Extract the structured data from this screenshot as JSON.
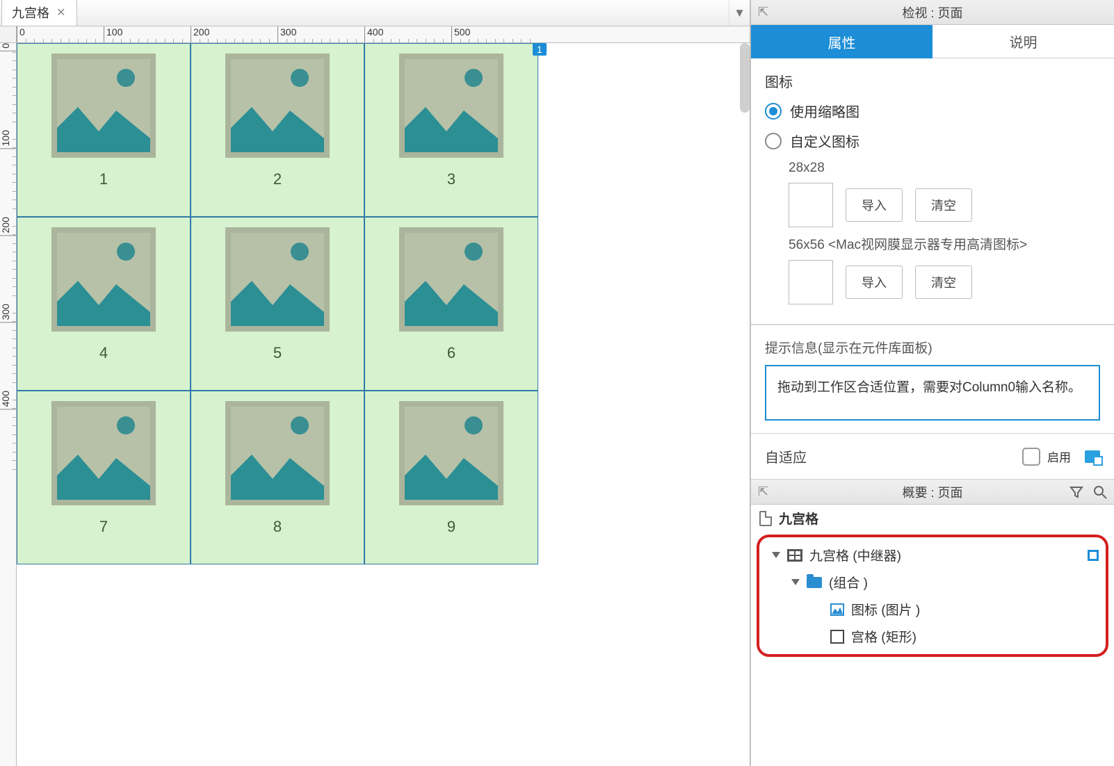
{
  "tab": {
    "title": "九宫格"
  },
  "ruler": {
    "h": [
      "0",
      "100",
      "200",
      "300",
      "400",
      "500"
    ],
    "v": [
      "0",
      "100",
      "200",
      "300",
      "400"
    ]
  },
  "badge": "1",
  "grid_labels": [
    "1",
    "2",
    "3",
    "4",
    "5",
    "6",
    "7",
    "8",
    "9"
  ],
  "inspector": {
    "panel_title": "检视 : 页面",
    "tabs": {
      "props": "属性",
      "notes": "说明"
    },
    "icon_section": "图标",
    "radio_thumb": "使用缩略图",
    "radio_custom": "自定义图标",
    "spec_small": "28x28",
    "spec_large": "56x56 <Mac视网膜显示器专用高清图标>",
    "btn_import": "导入",
    "btn_clear": "清空",
    "hint_label": "提示信息(显示在元件库面板)",
    "hint_text": "拖动到工作区合适位置，需要对Column0输入名称。",
    "adaptive_label": "自适应",
    "enable_label": "启用"
  },
  "outline": {
    "panel_title": "概要 : 页面",
    "page_name": "九宫格",
    "repeater": "九宫格 (中继器)",
    "group": "(组合 )",
    "image_item": "图标 (图片 )",
    "rect_item": "宫格 (矩形)"
  }
}
